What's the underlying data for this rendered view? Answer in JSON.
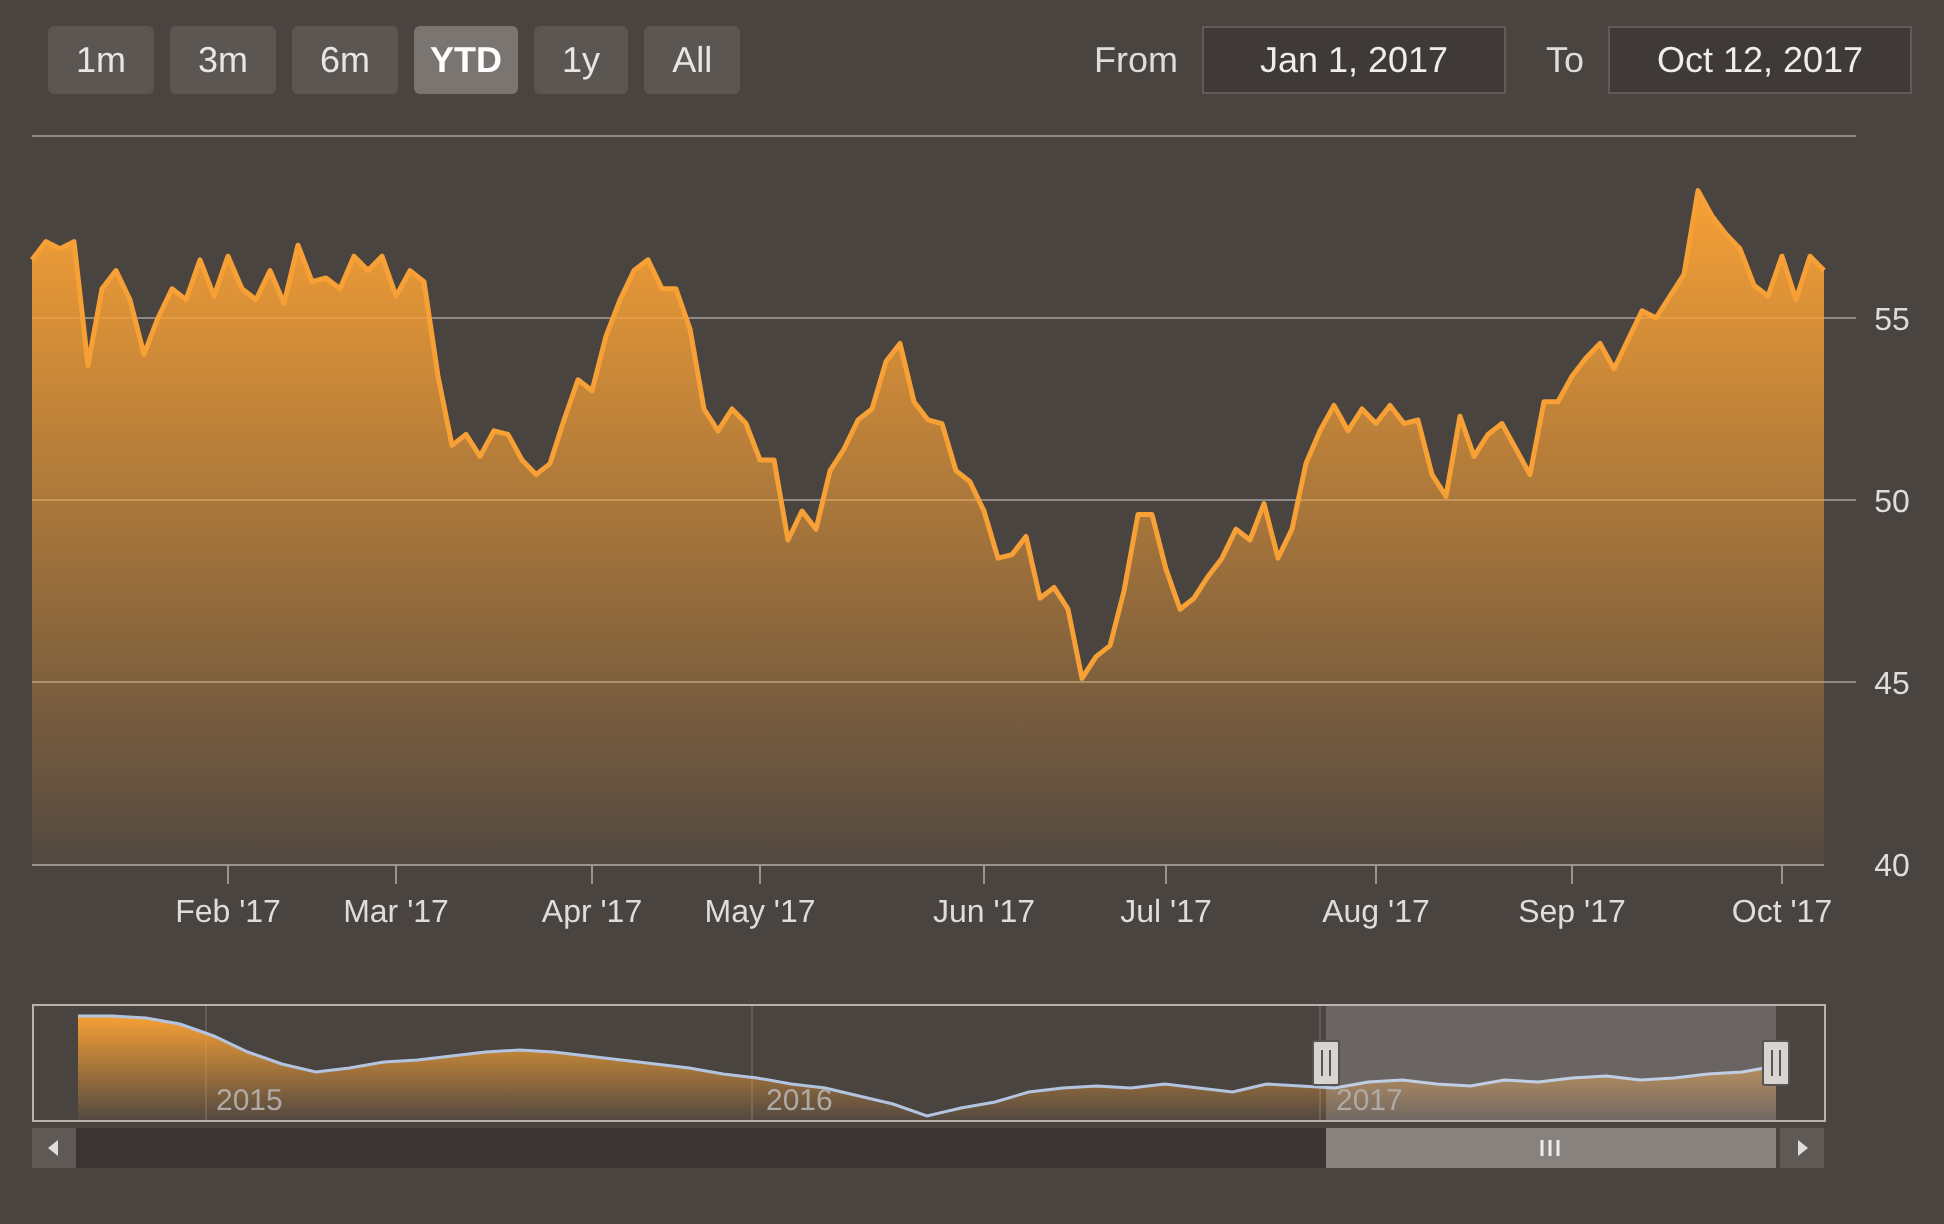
{
  "range_selector": {
    "buttons": [
      {
        "label": "1m",
        "selected": false
      },
      {
        "label": "3m",
        "selected": false
      },
      {
        "label": "6m",
        "selected": false
      },
      {
        "label": "YTD",
        "selected": true
      },
      {
        "label": "1y",
        "selected": false
      },
      {
        "label": "All",
        "selected": false
      }
    ],
    "from": {
      "label": "From",
      "value": "Jan 1, 2017"
    },
    "to": {
      "label": "To",
      "value": "Oct 12, 2017"
    }
  },
  "chart": {
    "chart_data": {
      "type": "area",
      "ylim": [
        40,
        60
      ],
      "grid": true,
      "yticks": [
        40,
        45,
        50,
        55
      ],
      "categories": [
        null,
        null,
        null,
        null,
        null,
        null,
        null,
        null,
        null,
        null,
        null,
        null,
        null,
        null,
        "Feb '17",
        null,
        null,
        null,
        null,
        null,
        null,
        null,
        null,
        null,
        null,
        null,
        "Mar '17",
        null,
        null,
        null,
        null,
        null,
        null,
        null,
        null,
        null,
        null,
        null,
        null,
        null,
        "Apr '17",
        null,
        null,
        null,
        null,
        null,
        null,
        null,
        null,
        null,
        null,
        null,
        "May '17",
        null,
        null,
        null,
        null,
        null,
        null,
        null,
        null,
        null,
        null,
        null,
        null,
        null,
        null,
        null,
        "Jun '17",
        null,
        null,
        null,
        null,
        null,
        null,
        null,
        null,
        null,
        null,
        null,
        null,
        "Jul '17",
        null,
        null,
        null,
        null,
        null,
        null,
        null,
        null,
        null,
        null,
        null,
        null,
        null,
        null,
        "Aug '17",
        null,
        null,
        null,
        null,
        null,
        null,
        null,
        null,
        null,
        null,
        null,
        null,
        null,
        "Sep '17",
        null,
        null,
        null,
        null,
        null,
        null,
        null,
        null,
        null,
        null,
        null,
        null,
        null,
        null,
        "Oct '17",
        null,
        null,
        null
      ],
      "series": [
        {
          "color": "#f7a035",
          "values": [
            56.6,
            57.1,
            56.9,
            57.1,
            53.7,
            55.8,
            56.3,
            55.5,
            54.0,
            55.0,
            55.8,
            55.5,
            56.6,
            55.6,
            56.7,
            55.8,
            55.5,
            56.3,
            55.4,
            57.0,
            56.0,
            56.1,
            55.8,
            56.7,
            56.3,
            56.7,
            55.6,
            56.3,
            56.0,
            53.4,
            51.5,
            51.8,
            51.2,
            51.9,
            51.8,
            51.1,
            50.7,
            51.0,
            52.2,
            53.3,
            53.0,
            54.5,
            55.5,
            56.3,
            56.6,
            55.8,
            55.8,
            54.7,
            52.5,
            51.9,
            52.5,
            52.1,
            51.1,
            51.1,
            48.9,
            49.7,
            49.2,
            50.8,
            51.4,
            52.2,
            52.5,
            53.8,
            54.3,
            52.7,
            52.2,
            52.1,
            50.8,
            50.5,
            49.7,
            48.4,
            48.5,
            49.0,
            47.3,
            47.6,
            47.0,
            45.1,
            45.7,
            46.0,
            47.5,
            49.6,
            49.6,
            48.1,
            47.0,
            47.3,
            47.9,
            48.4,
            49.2,
            48.9,
            49.9,
            48.4,
            49.2,
            51.0,
            51.9,
            52.6,
            51.9,
            52.5,
            52.1,
            52.6,
            52.1,
            52.2,
            50.7,
            50.1,
            52.3,
            51.2,
            51.8,
            52.1,
            51.4,
            50.7,
            52.7,
            52.7,
            53.4,
            53.9,
            54.3,
            53.6,
            54.4,
            55.2,
            55.0,
            55.6,
            56.2,
            58.5,
            57.8,
            57.3,
            56.9,
            55.9,
            55.6,
            56.7,
            55.5,
            56.7,
            56.3
          ]
        }
      ]
    }
  },
  "navigator": {
    "year_labels": [
      "2015",
      "2016",
      "2017"
    ]
  }
}
